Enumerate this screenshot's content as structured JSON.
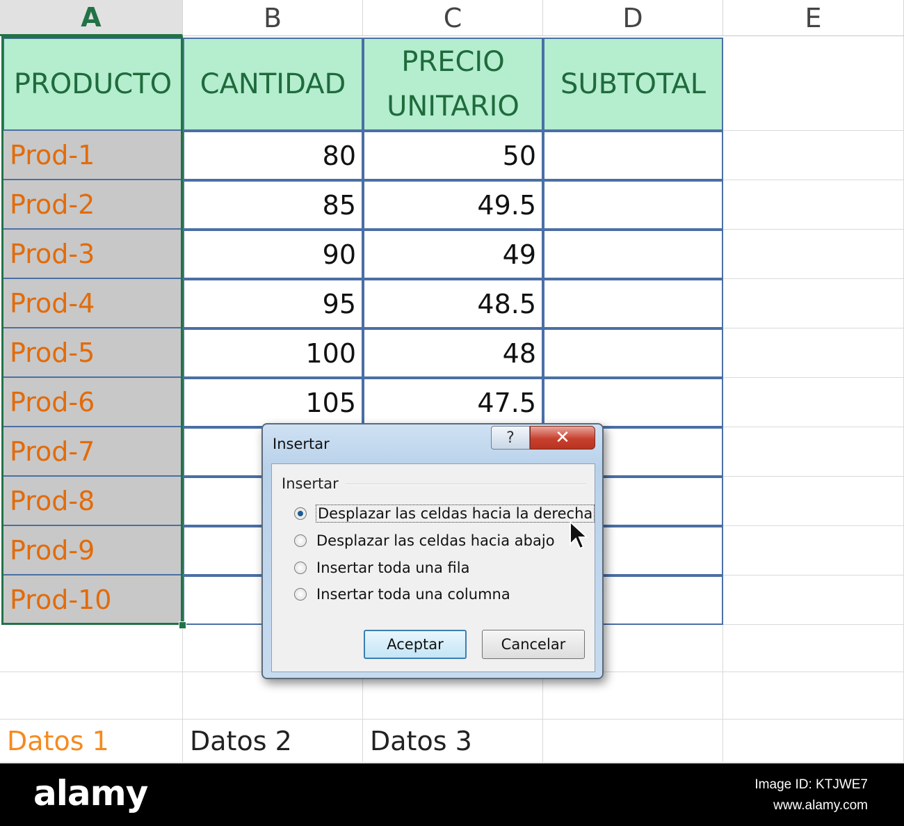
{
  "columns": [
    "A",
    "B",
    "C",
    "D",
    "E"
  ],
  "headers": {
    "producto": "PRODUCTO",
    "cantidad": "CANTIDAD",
    "precio_line1": "PRECIO",
    "precio_line2": "UNITARIO",
    "subtotal": "SUBTOTAL"
  },
  "rows": [
    {
      "producto": "Prod-1",
      "cantidad": "80",
      "precio": "50"
    },
    {
      "producto": "Prod-2",
      "cantidad": "85",
      "precio": "49.5"
    },
    {
      "producto": "Prod-3",
      "cantidad": "90",
      "precio": "49"
    },
    {
      "producto": "Prod-4",
      "cantidad": "95",
      "precio": "48.5"
    },
    {
      "producto": "Prod-5",
      "cantidad": "100",
      "precio": "48"
    },
    {
      "producto": "Prod-6",
      "cantidad": "105",
      "precio": "47.5"
    },
    {
      "producto": "Prod-7",
      "cantidad": "",
      "precio": ""
    },
    {
      "producto": "Prod-8",
      "cantidad": "",
      "precio": ""
    },
    {
      "producto": "Prod-9",
      "cantidad": "",
      "precio": ""
    },
    {
      "producto": "Prod-10",
      "cantidad": "",
      "precio": ""
    }
  ],
  "datos": [
    "Datos 1",
    "Datos 2",
    "Datos 3"
  ],
  "dialog": {
    "title": "Insertar",
    "help_glyph": "?",
    "close_glyph": "✕",
    "group_label": "Insertar",
    "options": [
      {
        "label": "Desplazar las celdas hacia la derecha",
        "checked": true
      },
      {
        "label": "Desplazar las celdas hacia abajo",
        "checked": false
      },
      {
        "label": "Insertar toda una fila",
        "checked": false
      },
      {
        "label": "Insertar toda una columna",
        "checked": false
      }
    ],
    "ok_label": "Aceptar",
    "cancel_label": "Cancelar"
  },
  "colors": {
    "header_fill": "#b5edcf",
    "header_text": "#1e6b3c",
    "product_text": "#e26b0a",
    "selection": "#217346"
  },
  "watermark": {
    "brand": "alamy",
    "image_id": "Image ID: KTJWE7",
    "site": "www.alamy.com"
  }
}
